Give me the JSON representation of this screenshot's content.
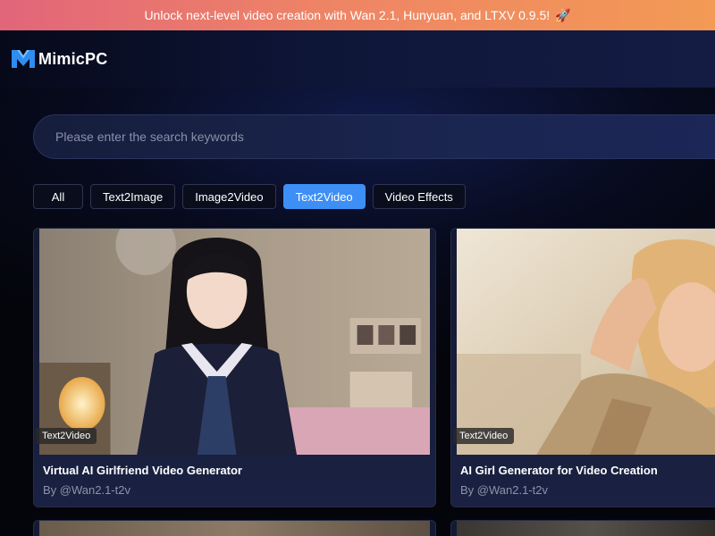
{
  "banner": {
    "text": "Unlock next-level video creation with Wan 2.1, Hunyuan, and LTXV 0.9.5!",
    "icon": "rocket-icon",
    "rocket_glyph": "🚀"
  },
  "header": {
    "logo_text": "MimicPC",
    "logo_icon": "mimicpc-logo-icon"
  },
  "search": {
    "placeholder": "Please enter the search keywords"
  },
  "tabs": [
    {
      "label": "All",
      "active": false
    },
    {
      "label": "Text2Image",
      "active": false
    },
    {
      "label": "Image2Video",
      "active": false
    },
    {
      "label": "Text2Video",
      "active": true
    },
    {
      "label": "Video Effects",
      "active": false
    }
  ],
  "cards": [
    {
      "badge": "Text2Video",
      "title": "Virtual AI Girlfriend Video Generator",
      "author": "By @Wan2.1-t2v"
    },
    {
      "badge": "Text2Video",
      "title": "AI Girl Generator for Video Creation",
      "author": "By @Wan2.1-t2v"
    }
  ],
  "colors": {
    "accent": "#3d8ff5",
    "banner_start": "#e2657a",
    "banner_end": "#f39a55",
    "background": "#05060c"
  }
}
